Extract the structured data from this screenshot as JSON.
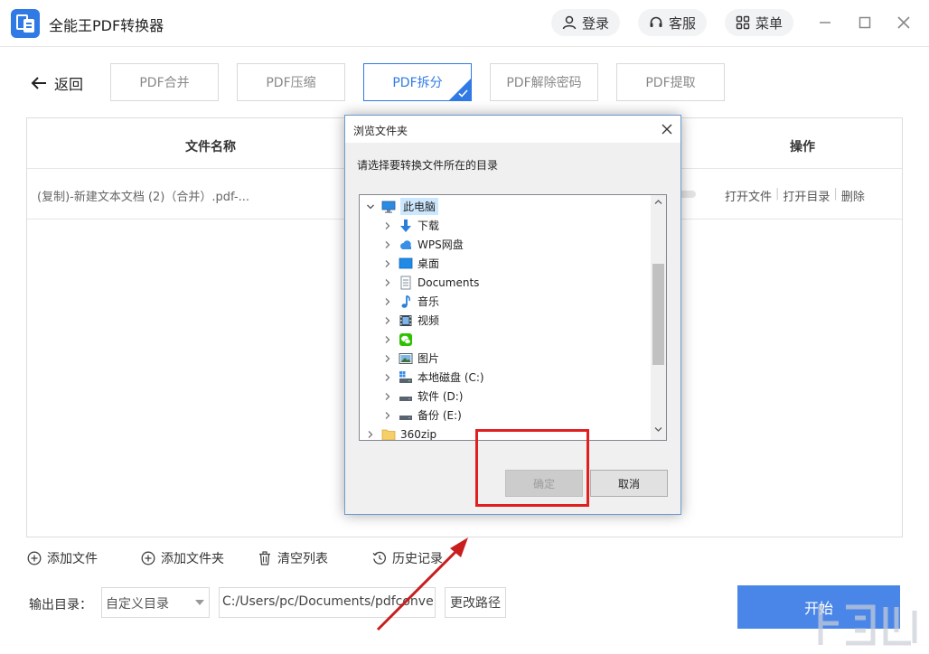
{
  "app": {
    "title": "全能王PDF转换器",
    "login_label": "登录",
    "service_label": "客服",
    "menu_label": "菜单"
  },
  "nav": {
    "back_label": "返回",
    "tabs": [
      {
        "label": "PDF合并",
        "active": false
      },
      {
        "label": "PDF压缩",
        "active": false
      },
      {
        "label": "PDF拆分",
        "active": true
      },
      {
        "label": "PDF解除密码",
        "active": false
      },
      {
        "label": "PDF提取",
        "active": false
      }
    ]
  },
  "table": {
    "col_name": "文件名称",
    "col_ops": "操作",
    "rows": [
      {
        "file_name": "(复制)-新建文本文档 (2)（合并）.pdf-...",
        "op_open_file": "打开文件",
        "op_open_dir": "打开目录",
        "op_delete": "删除"
      }
    ]
  },
  "actions": {
    "add_file": "添加文件",
    "add_folder": "添加文件夹",
    "clear_list": "清空列表",
    "history": "历史记录"
  },
  "output": {
    "label": "输出目录：",
    "mode": "自定义目录",
    "path": "C:/Users/pc/Documents/pdfconvert",
    "change_label": "更改路径",
    "start_label": "开始"
  },
  "dialog": {
    "title": "浏览文件夹",
    "instruction": "请选择要转换文件所在的目录",
    "tree": [
      {
        "label": "此电脑",
        "icon": "computer-icon",
        "expanded": true,
        "selected": true,
        "level": 0
      },
      {
        "label": "下载",
        "icon": "download-icon",
        "level": 1
      },
      {
        "label": "WPS网盘",
        "icon": "cloud-icon",
        "level": 1
      },
      {
        "label": "桌面",
        "icon": "desktop-icon",
        "level": 1
      },
      {
        "label": "Documents",
        "icon": "document-icon",
        "level": 1
      },
      {
        "label": "音乐",
        "icon": "music-icon",
        "level": 1
      },
      {
        "label": "视频",
        "icon": "video-icon",
        "level": 1
      },
      {
        "label": "",
        "icon": "wechat-icon",
        "level": 1
      },
      {
        "label": "图片",
        "icon": "picture-icon",
        "level": 1
      },
      {
        "label": "本地磁盘 (C:)",
        "icon": "system-drive-icon",
        "level": 1
      },
      {
        "label": "软件 (D:)",
        "icon": "drive-icon",
        "level": 1
      },
      {
        "label": "备份 (E:)",
        "icon": "drive-icon",
        "level": 1
      },
      {
        "label": "360zip",
        "icon": "folder-icon",
        "level": 0
      }
    ],
    "ok_label": "确定",
    "cancel_label": "取消"
  },
  "colors": {
    "accent": "#2f7ae5",
    "start_button": "#4a86e8",
    "annotation": "#e02020"
  }
}
